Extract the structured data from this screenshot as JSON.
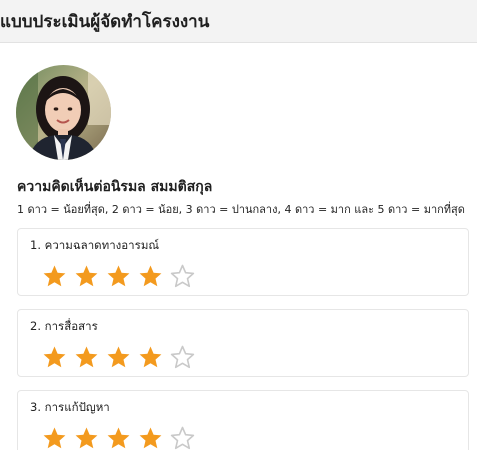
{
  "header": {
    "title": "แบบประเมินผู้จัดทำโครงงาน"
  },
  "profile": {
    "name": "ความคิดเห็นต่อนิรมล สมมติสกุล",
    "rating_legend": "1 ดาว = น้อยที่สุด, 2 ดาว = น้อย, 3 ดาว = ปานกลาง, 4 ดาว = มาก และ 5 ดาว = มากที่สุด"
  },
  "questions": [
    {
      "label": "1. ความฉลาดทางอารมณ์",
      "rating": 4,
      "max": 5
    },
    {
      "label": "2. การสื่อสาร",
      "rating": 4,
      "max": 5
    },
    {
      "label": "3. การแก้ปัญหา",
      "rating": 4,
      "max": 5
    }
  ],
  "colors": {
    "star_filled": "#f39a1e",
    "star_empty": "#c9c9c9",
    "header_bg": "#f3f3f3"
  }
}
